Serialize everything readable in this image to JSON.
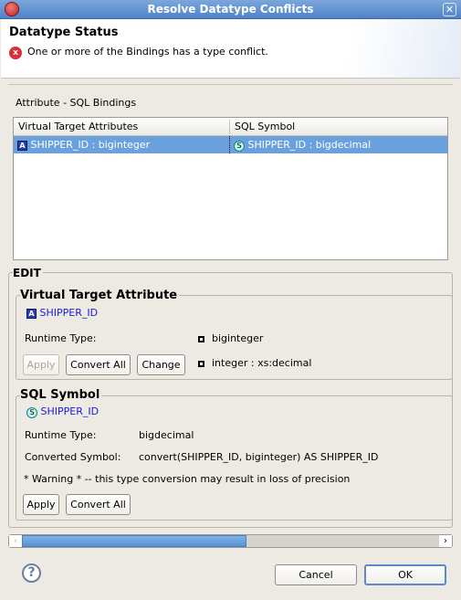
{
  "window": {
    "title": "Resolve Datatype Conflicts"
  },
  "banner": {
    "title": "Datatype Status",
    "message": "One or more of the Bindings has a type conflict."
  },
  "bindings": {
    "label": "Attribute - SQL Bindings",
    "columns": [
      "Virtual Target Attributes",
      "SQL Symbol"
    ],
    "rows": [
      {
        "attribute": "SHIPPER_ID : biginteger",
        "symbol": "SHIPPER_ID : bigdecimal",
        "selected": true
      }
    ]
  },
  "edit": {
    "title": "EDIT",
    "vta": {
      "title": "Virtual Target Attribute",
      "name": "SHIPPER_ID",
      "runtime_label": "Runtime Type:",
      "options": [
        "biginteger",
        "integer : xs:decimal"
      ],
      "buttons": {
        "apply": "Apply",
        "convert_all": "Convert All",
        "change": "Change"
      }
    },
    "sql": {
      "title": "SQL Symbol",
      "name": "SHIPPER_ID",
      "runtime_label": "Runtime Type:",
      "runtime_value": "bigdecimal",
      "converted_label": "Converted Symbol:",
      "converted_value": "convert(SHIPPER_ID, biginteger) AS SHIPPER_ID",
      "warning": "* Warning * -- this type conversion may result in loss of precision",
      "buttons": {
        "apply": "Apply",
        "convert_all": "Convert All"
      }
    }
  },
  "scrollbar": {
    "position_fraction": 0.0,
    "visible_fraction": 0.52
  },
  "footer": {
    "help": "?",
    "cancel": "Cancel",
    "ok": "OK"
  },
  "icons": {
    "app": "app-icon",
    "close": "close-icon",
    "error": "error-icon",
    "attribute": "attribute-icon",
    "symbol": "symbol-icon",
    "help": "help-icon"
  }
}
